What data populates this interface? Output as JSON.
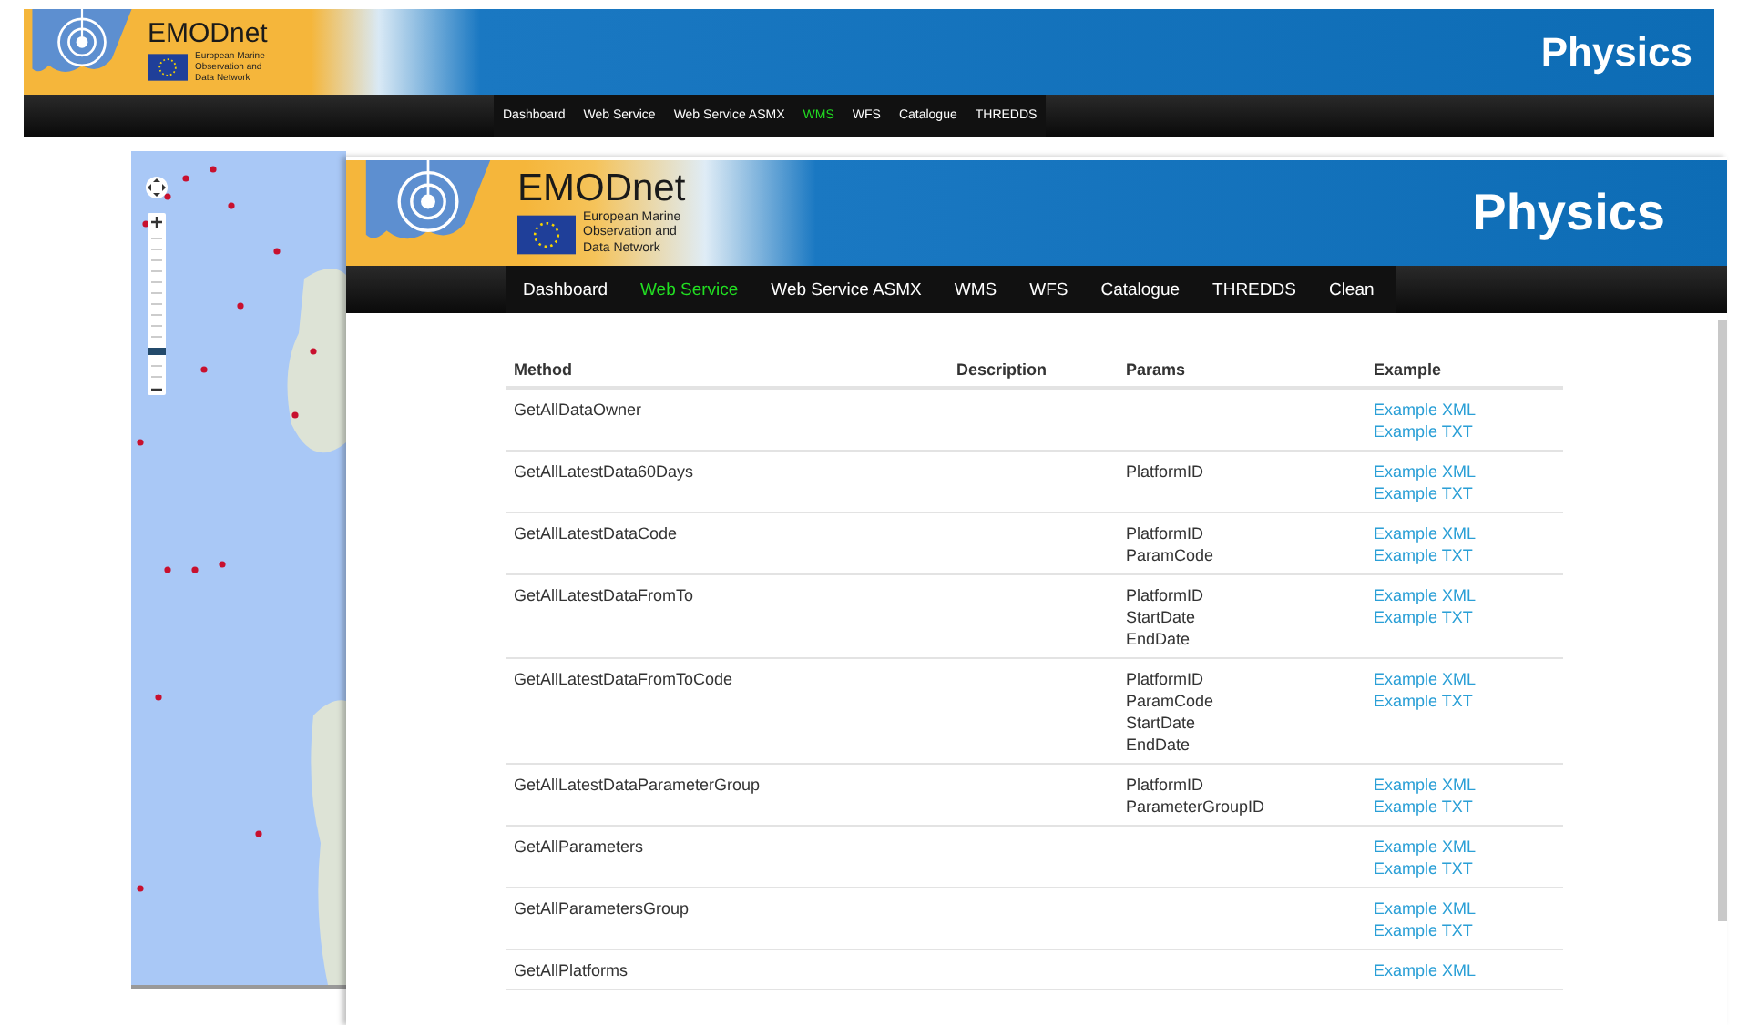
{
  "background_page": {
    "header": {
      "brand": "EMODnet",
      "subtitle": [
        "European Marine",
        "Observation and",
        "Data Network"
      ],
      "section": "Physics"
    },
    "nav": [
      {
        "label": "Dashboard",
        "selected": false
      },
      {
        "label": "Web Service",
        "selected": false
      },
      {
        "label": "Web Service ASMX",
        "selected": false
      },
      {
        "label": "WMS",
        "selected": true
      },
      {
        "label": "WFS",
        "selected": false
      },
      {
        "label": "Catalogue",
        "selected": false
      },
      {
        "label": "THREDDS",
        "selected": false
      }
    ]
  },
  "page": {
    "header": {
      "brand": "EMODnet",
      "subtitle": [
        "European Marine",
        "Observation and",
        "Data Network"
      ],
      "section": "Physics"
    },
    "nav": [
      {
        "label": "Dashboard",
        "selected": false
      },
      {
        "label": "Web Service",
        "selected": true
      },
      {
        "label": "Web Service ASMX",
        "selected": false
      },
      {
        "label": "WMS",
        "selected": false
      },
      {
        "label": "WFS",
        "selected": false
      },
      {
        "label": "Catalogue",
        "selected": false
      },
      {
        "label": "THREDDS",
        "selected": false
      },
      {
        "label": "Clean",
        "selected": false
      }
    ],
    "table": {
      "columns": [
        "Method",
        "Description",
        "Params",
        "Example"
      ],
      "rows": [
        {
          "method": "GetAllDataOwner",
          "params": [],
          "examples": [
            "Example XML",
            "Example TXT"
          ]
        },
        {
          "method": "GetAllLatestData60Days",
          "params": [
            "PlatformID"
          ],
          "examples": [
            "Example XML",
            "Example TXT"
          ]
        },
        {
          "method": "GetAllLatestDataCode",
          "params": [
            "PlatformID",
            "ParamCode"
          ],
          "examples": [
            "Example XML",
            "Example TXT"
          ]
        },
        {
          "method": "GetAllLatestDataFromTo",
          "params": [
            "PlatformID",
            "StartDate",
            "EndDate"
          ],
          "examples": [
            "Example XML",
            "Example TXT"
          ]
        },
        {
          "method": "GetAllLatestDataFromToCode",
          "params": [
            "PlatformID",
            "ParamCode",
            "StartDate",
            "EndDate"
          ],
          "examples": [
            "Example XML",
            "Example TXT"
          ]
        },
        {
          "method": "GetAllLatestDataParameterGroup",
          "params": [
            "PlatformID",
            "ParameterGroupID"
          ],
          "examples": [
            "Example XML",
            "Example TXT"
          ]
        },
        {
          "method": "GetAllParameters",
          "params": [],
          "examples": [
            "Example XML",
            "Example TXT"
          ]
        },
        {
          "method": "GetAllParametersGroup",
          "params": [],
          "examples": [
            "Example XML",
            "Example TXT"
          ]
        },
        {
          "method": "GetAllPlatforms",
          "params": [],
          "examples": [
            "Example XML"
          ]
        }
      ]
    }
  }
}
